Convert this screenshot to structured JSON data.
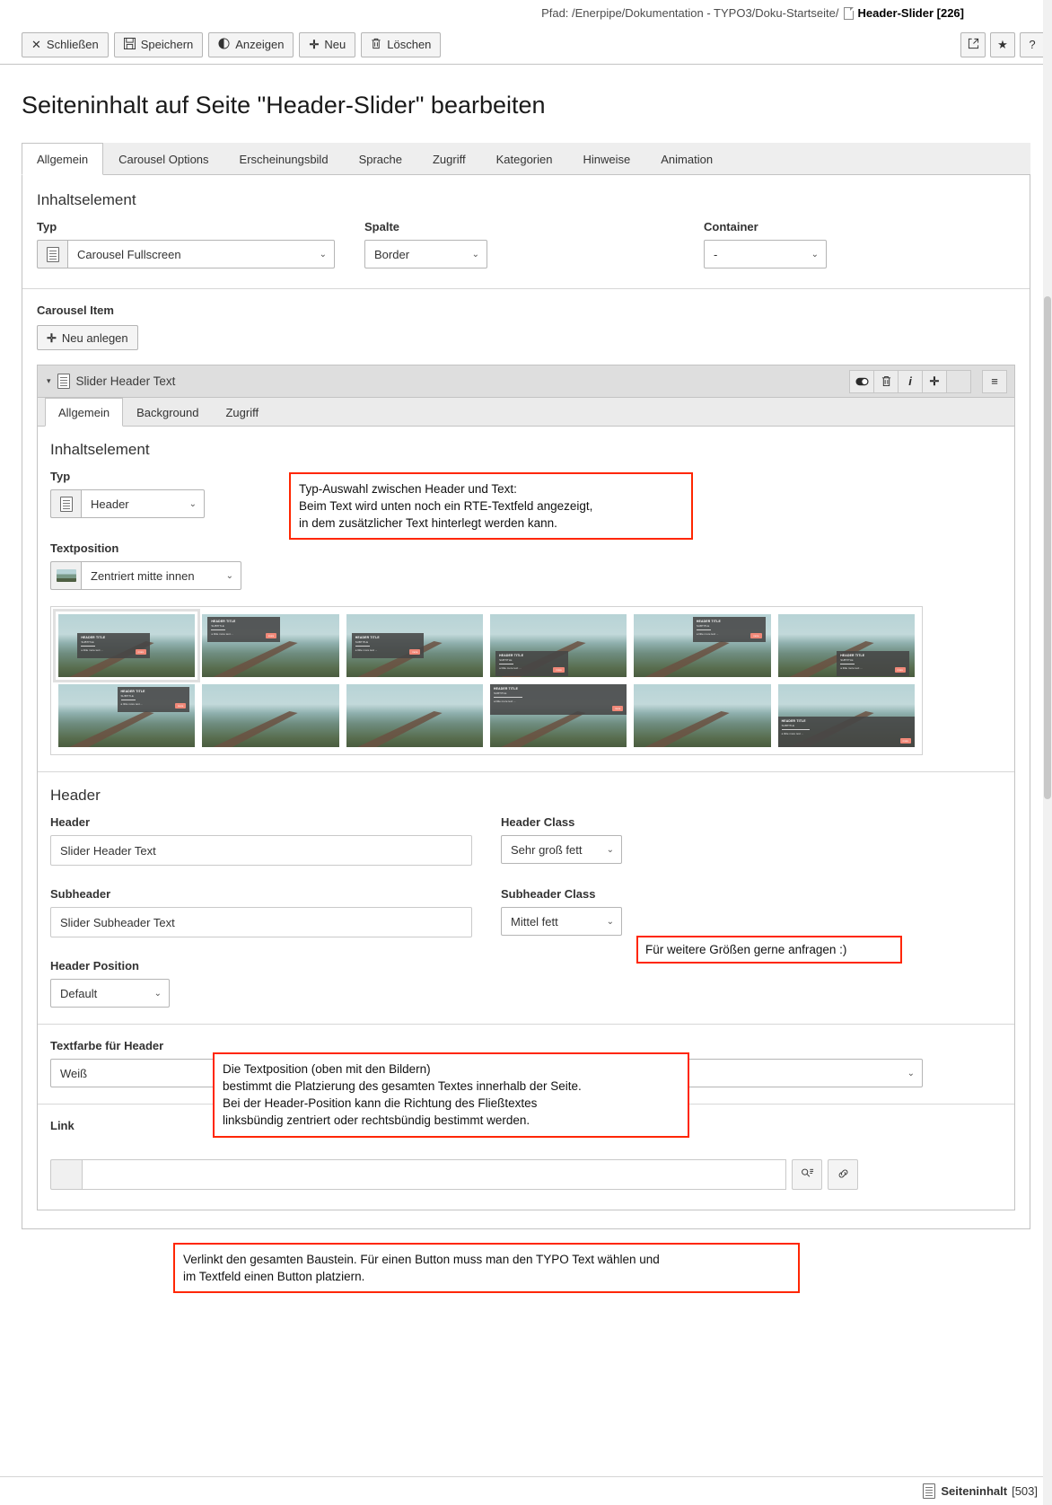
{
  "pathbar": {
    "label": "Pfad: /Enerpipe/Dokumentation - TYPO3/Doku-Startseite/",
    "record_icon": "page-icon",
    "record": "Header-Slider [226]"
  },
  "toolbar": {
    "buttons": [
      {
        "icon": "✕",
        "icon_name": "close-icon",
        "label": "Schließen"
      },
      {
        "icon": "💾",
        "icon_name": "save-icon",
        "label": "Speichern"
      },
      {
        "icon": "◉",
        "icon_name": "view-icon",
        "label": "Anzeigen"
      },
      {
        "icon": "✛",
        "icon_name": "plus-icon",
        "label": "Neu"
      },
      {
        "icon": "🗑",
        "icon_name": "trash-icon",
        "label": "Löschen"
      }
    ],
    "right_buttons": [
      {
        "icon": "⬈",
        "icon_name": "open-external-icon",
        "title": "Open in new window"
      },
      {
        "icon": "★",
        "icon_name": "star-icon",
        "title": "Bookmark"
      },
      {
        "icon": "?",
        "icon_name": "help-icon",
        "title": "Help"
      }
    ]
  },
  "page_title": "Seiteninhalt auf Seite \"Header-Slider\" bearbeiten",
  "tabs": [
    {
      "label": "Allgemein",
      "active": true
    },
    {
      "label": "Carousel Options",
      "active": false
    },
    {
      "label": "Erscheinungsbild",
      "active": false
    },
    {
      "label": "Sprache",
      "active": false
    },
    {
      "label": "Zugriff",
      "active": false
    },
    {
      "label": "Kategorien",
      "active": false
    },
    {
      "label": "Hinweise",
      "active": false
    },
    {
      "label": "Animation",
      "active": false
    }
  ],
  "content_element": {
    "legend": "Inhaltselement",
    "typ": {
      "label": "Typ",
      "value": "Carousel Fullscreen",
      "icon": "content-icon"
    },
    "spalte": {
      "label": "Spalte",
      "value": "Border"
    },
    "container": {
      "label": "Container",
      "value": "-"
    }
  },
  "carousel_item": {
    "label": "Carousel Item",
    "new_button": {
      "icon": "+",
      "label": "Neu anlegen"
    }
  },
  "inline": {
    "title": "Slider Header Text",
    "icon": "content-icon",
    "caret": "▾",
    "actions": [
      {
        "name": "toggle-hide-icon",
        "glyph": "◐"
      },
      {
        "name": "delete-icon",
        "glyph": "🗑"
      },
      {
        "name": "info-icon",
        "glyph": "i"
      },
      {
        "name": "create-new-icon",
        "glyph": "✛"
      },
      {
        "name": "empty-slot",
        "glyph": ""
      },
      {
        "name": "drag-handle-icon",
        "glyph": "≡"
      }
    ],
    "tabs": [
      {
        "label": "Allgemein",
        "active": true
      },
      {
        "label": "Background",
        "active": false
      },
      {
        "label": "Zugriff",
        "active": false
      }
    ],
    "content_element": {
      "legend": "Inhaltselement",
      "typ": {
        "label": "Typ",
        "value": "Header",
        "icon": "content-icon"
      }
    },
    "textposition": {
      "label": "Textposition",
      "value": "Zentriert mitte innen",
      "preview_icon": "image-thumb-icon",
      "thumbnails": [
        {
          "pos": "center-middle",
          "selected": true
        },
        {
          "pos": "top-left",
          "selected": false
        },
        {
          "pos": "center-left-middle",
          "selected": false
        },
        {
          "pos": "bottom-left",
          "selected": false
        },
        {
          "pos": "top-right",
          "selected": false
        },
        {
          "pos": "bottom-right-inner",
          "selected": false
        },
        {
          "pos": "top-right-2",
          "selected": false
        },
        {
          "pos": "none-1",
          "selected": false
        },
        {
          "pos": "none-2",
          "selected": false
        },
        {
          "pos": "top-wide",
          "selected": false
        },
        {
          "pos": "none-3",
          "selected": false
        },
        {
          "pos": "bottom-wide",
          "selected": false
        }
      ],
      "overlay_text": {
        "title": "HEADER TITLE",
        "subtitle": "SUBTITLE",
        "body": "a little more text ...",
        "button": "more"
      }
    },
    "header_section": {
      "legend": "Header",
      "header": {
        "label": "Header",
        "value": "Slider Header Text"
      },
      "header_class": {
        "label": "Header Class",
        "value": "Sehr groß fett"
      },
      "subheader": {
        "label": "Subheader",
        "value": "Slider Subheader Text"
      },
      "subheader_class": {
        "label": "Subheader Class",
        "value": "Mittel fett"
      },
      "header_position": {
        "label": "Header Position",
        "value": "Default"
      }
    },
    "textfarbe": {
      "label": "Textfarbe für Header",
      "value": "Weiß"
    },
    "link": {
      "label": "Link",
      "value": "",
      "browse_icon": "link-browse-icon",
      "edit_icon": "link-chain-icon"
    }
  },
  "annotations": [
    {
      "id": "note-typ",
      "text": "Typ-Auswahl zwischen Header und Text:\nBeim Text wird unten noch ein RTE-Textfeld angezeigt,\nin dem zusätzlicher Text hinterlegt werden kann."
    },
    {
      "id": "note-header-class",
      "text": "Für weitere Größen gerne anfragen :)"
    },
    {
      "id": "note-header-position",
      "text": "Die Textposition (oben mit den Bildern)\nbestimmt die Platzierung des gesamten Textes innerhalb der Seite.\nBei der Header-Position kann die Richtung des Fließtextes\nlinksbündig zentriert oder rechtsbündig bestimmt werden."
    },
    {
      "id": "note-link",
      "text": "Verlinkt den gesamten Baustein. Für einen Button muss man den TYPO Text wählen und\nim Textfeld einen Button platziern."
    }
  ],
  "footer": {
    "icon": "content-icon",
    "label": "Seiteninhalt",
    "uid": "[503]"
  },
  "colors": {
    "annotation_border": "#ff2600",
    "header_bar": "#dedede",
    "tab_bar": "#eeeeee",
    "accent_more_button": "#f08878"
  }
}
